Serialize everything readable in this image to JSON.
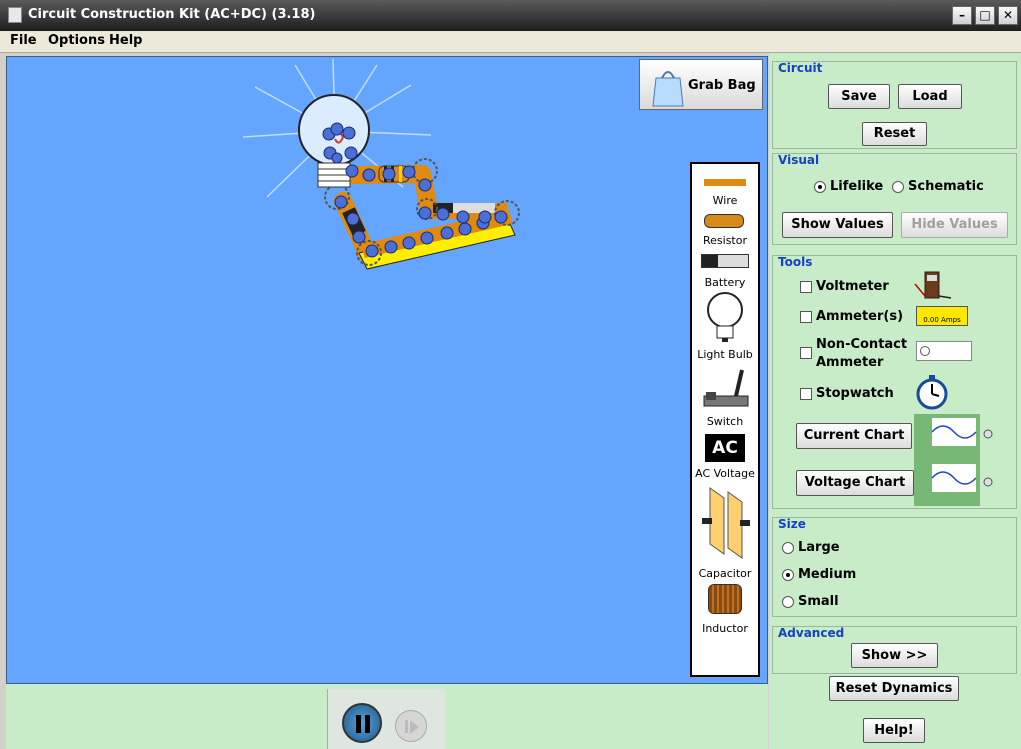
{
  "window": {
    "title": "Circuit Construction Kit (AC+DC) (3.18)"
  },
  "menu": {
    "file": "File",
    "options": "Options",
    "help": "Help"
  },
  "canvas": {
    "grab_bag": "Grab Bag"
  },
  "toolbox": {
    "items": [
      {
        "label": "Wire"
      },
      {
        "label": "Resistor"
      },
      {
        "label": "Battery"
      },
      {
        "label": "Light Bulb"
      },
      {
        "label": "Switch"
      },
      {
        "label": "AC Voltage"
      },
      {
        "label": "Capacitor"
      },
      {
        "label": "Inductor"
      }
    ],
    "ac_badge": "AC"
  },
  "panel": {
    "circuit": {
      "title": "Circuit",
      "save": "Save",
      "load": "Load",
      "reset": "Reset"
    },
    "visual": {
      "title": "Visual",
      "lifelike": "Lifelike",
      "schematic": "Schematic",
      "show_values": "Show Values",
      "hide_values": "Hide Values",
      "selected": "Lifelike"
    },
    "tools": {
      "title": "Tools",
      "voltmeter": "Voltmeter",
      "ammeter": "Ammeter(s)",
      "noncontact_1": "Non-Contact",
      "noncontact_2": "Ammeter",
      "stopwatch": "Stopwatch",
      "current_chart": "Current Chart",
      "voltage_chart": "Voltage Chart",
      "ammeter_readout": "0.00 Amps"
    },
    "size": {
      "title": "Size",
      "large": "Large",
      "medium": "Medium",
      "small": "Small",
      "selected": "Medium"
    },
    "advanced": {
      "title": "Advanced",
      "show": "Show >>",
      "reset_dynamics": "Reset Dynamics",
      "help": "Help!"
    }
  },
  "colors": {
    "canvas_bg": "#64a5ff",
    "panel_bg": "#c8ebc8",
    "group_title": "#1540c8",
    "wire": "#e08a10"
  }
}
